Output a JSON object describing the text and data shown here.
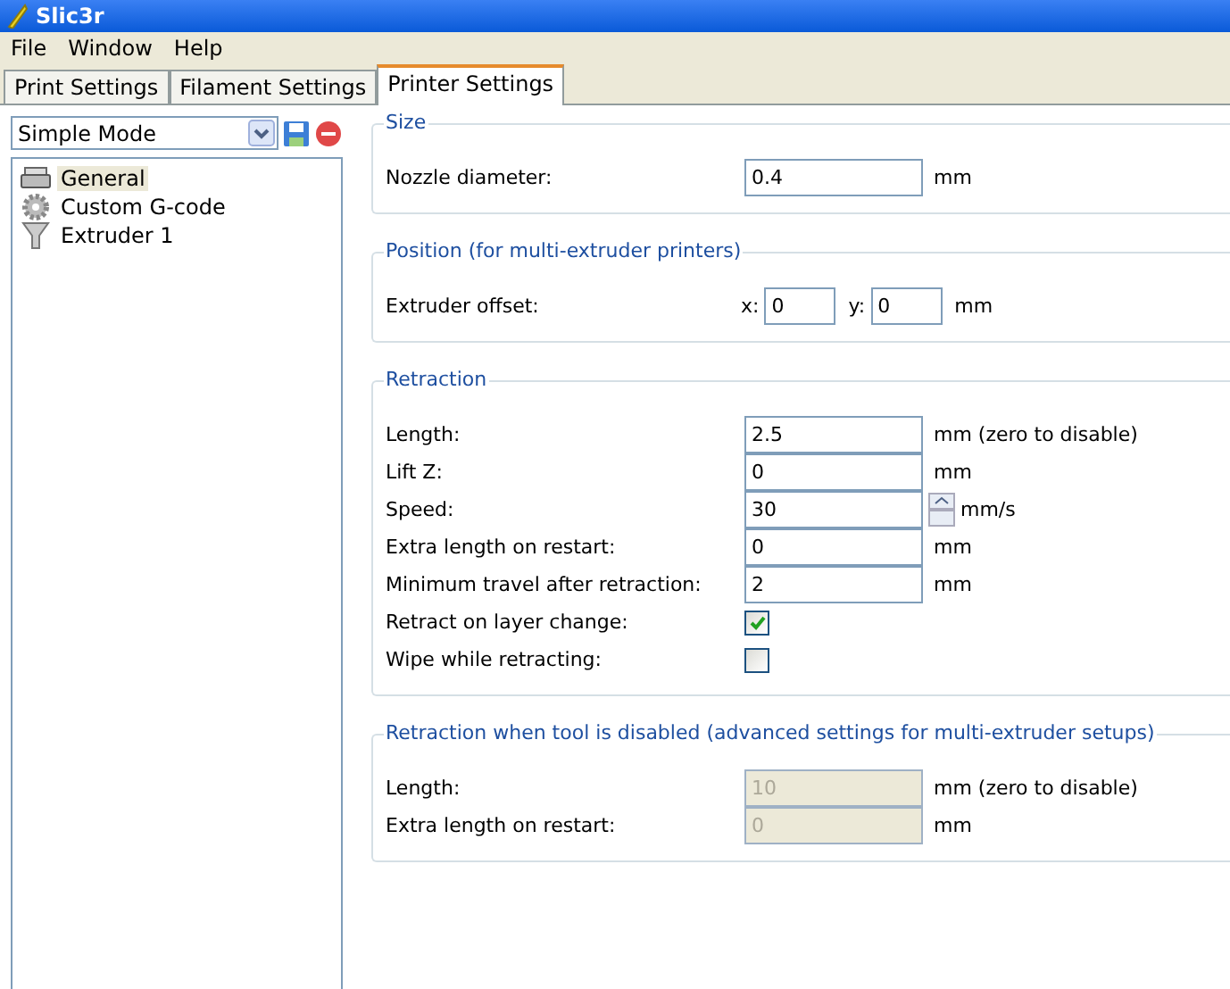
{
  "window": {
    "title": "Slic3r"
  },
  "menu": [
    "File",
    "Window",
    "Help"
  ],
  "tabs": [
    {
      "label": "Print Settings",
      "selected": false
    },
    {
      "label": "Filament Settings",
      "selected": false
    },
    {
      "label": "Printer Settings",
      "selected": true
    }
  ],
  "preset": {
    "value": "Simple Mode"
  },
  "tree": [
    {
      "label": "General",
      "kind": "printer",
      "selected": true
    },
    {
      "label": "Custom G-code",
      "kind": "gear",
      "selected": false
    },
    {
      "label": "Extruder 1",
      "kind": "funnel",
      "selected": false
    }
  ],
  "groups": [
    {
      "title": "Size",
      "rows": [
        {
          "kind": "text",
          "label": "Nozzle diameter:",
          "value": "0.4",
          "unit": "mm",
          "disabled": false
        }
      ]
    },
    {
      "title": "Position (for multi-extruder printers)",
      "rows": [
        {
          "kind": "xy",
          "label": "Extruder offset:",
          "x_label": "x:",
          "x_value": "0",
          "y_label": "y:",
          "y_value": "0",
          "unit": "mm"
        }
      ]
    },
    {
      "title": "Retraction",
      "rows": [
        {
          "kind": "text",
          "label": "Length:",
          "value": "2.5",
          "unit": "mm (zero to disable)",
          "disabled": false
        },
        {
          "kind": "text",
          "label": "Lift Z:",
          "value": "0",
          "unit": "mm",
          "disabled": false
        },
        {
          "kind": "spin",
          "label": "Speed:",
          "value": "30",
          "unit": "mm/s",
          "disabled": false
        },
        {
          "kind": "text",
          "label": "Extra length on restart:",
          "value": "0",
          "unit": "mm",
          "disabled": false
        },
        {
          "kind": "text",
          "label": "Minimum travel after retraction:",
          "value": "2",
          "unit": "mm",
          "disabled": false
        },
        {
          "kind": "checkbox",
          "label": "Retract on layer change:",
          "checked": true
        },
        {
          "kind": "checkbox",
          "label": "Wipe while retracting:",
          "checked": false
        }
      ]
    },
    {
      "title": "Retraction when tool is disabled (advanced settings for multi-extruder setups)",
      "rows": [
        {
          "kind": "text",
          "label": "Length:",
          "value": "10",
          "unit": "mm (zero to disable)",
          "disabled": true
        },
        {
          "kind": "text",
          "label": "Extra length on restart:",
          "value": "0",
          "unit": "mm",
          "disabled": true
        }
      ]
    }
  ]
}
